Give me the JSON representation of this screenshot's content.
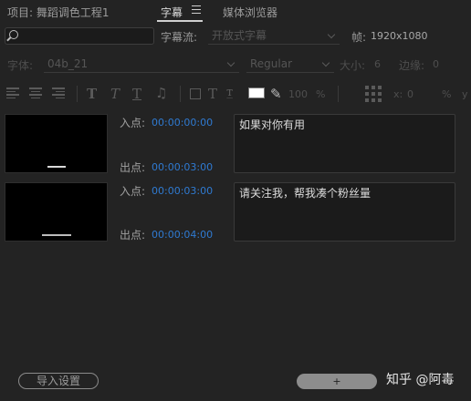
{
  "tabs": {
    "project": "项目: 舞蹈调色工程1",
    "captions": "字幕",
    "media_browser": "媒体浏览器"
  },
  "search": {
    "placeholder": ""
  },
  "caption_stream": {
    "label": "字幕流:",
    "value": "开放式字幕"
  },
  "frame": {
    "label": "帧:",
    "value": "1920x1080"
  },
  "font": {
    "label": "字体:",
    "family": "04b_21",
    "style": "Regular"
  },
  "size": {
    "label": "大小:",
    "value": "6"
  },
  "edge": {
    "label": "边缘:",
    "value": "0"
  },
  "toolbar": {
    "opacity": "100",
    "opacity_unit": "%",
    "x_label": "x:",
    "x_value": "0",
    "percent": "%",
    "y_label": "y",
    "colors": {
      "text": "#ffffff"
    },
    "icons": [
      "align-left-icon",
      "align-center-icon",
      "align-right-icon",
      "bold-icon",
      "italic-icon",
      "underline-icon",
      "music-note-icon",
      "background-icon",
      "text-color-icon",
      "edge-icon",
      "eyedropper-icon",
      "position-grid-icon"
    ]
  },
  "captions": [
    {
      "in_label": "入点:",
      "in_time": "00:00:00:00",
      "out_label": "出点:",
      "out_time": "00:00:03:00",
      "text": "如果对你有用"
    },
    {
      "in_label": "入点:",
      "in_time": "00:00:03:00",
      "out_label": "出点:",
      "out_time": "00:00:04:00",
      "text": "请关注我，帮我凑个粉丝量"
    }
  ],
  "footer": {
    "import_settings": "导入设置",
    "add": "+",
    "watermark": "知乎 @阿毒"
  },
  "colors": {
    "accent_timecode": "#2f7ad1",
    "background": "#232323"
  }
}
